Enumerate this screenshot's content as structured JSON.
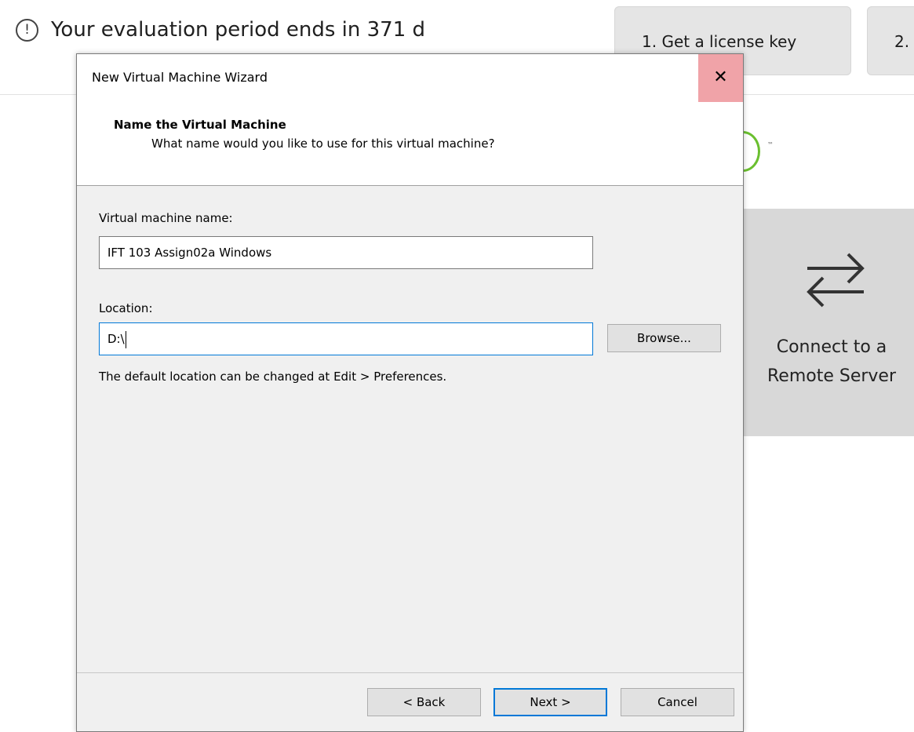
{
  "background": {
    "evaluation_text": "Your evaluation period ends in 371 d",
    "info_icon": "!",
    "top_buttons": [
      "1. Get a license key",
      "2."
    ],
    "logo_tm": "™",
    "remote_tile": {
      "icon": "swap-arrows-icon",
      "label": "Connect to a Remote Server"
    }
  },
  "dialog": {
    "title": "New Virtual Machine Wizard",
    "close_glyph": "✕",
    "header": {
      "title": "Name the Virtual Machine",
      "subtitle": "What name would you like to use for this virtual machine?"
    },
    "vm_name": {
      "label": "Virtual machine name:",
      "value": "IFT 103 Assign02a Windows"
    },
    "location": {
      "label": "Location:",
      "value": "D:\\",
      "browse_label": "Browse...",
      "hint": "The default location can be changed at Edit > Preferences."
    },
    "buttons": {
      "back": "< Back",
      "next": "Next >",
      "cancel": "Cancel"
    }
  },
  "colors": {
    "close_hover": "#f0a3a8",
    "focus_border": "#0078d7",
    "logo_green": "#6abf2f"
  }
}
